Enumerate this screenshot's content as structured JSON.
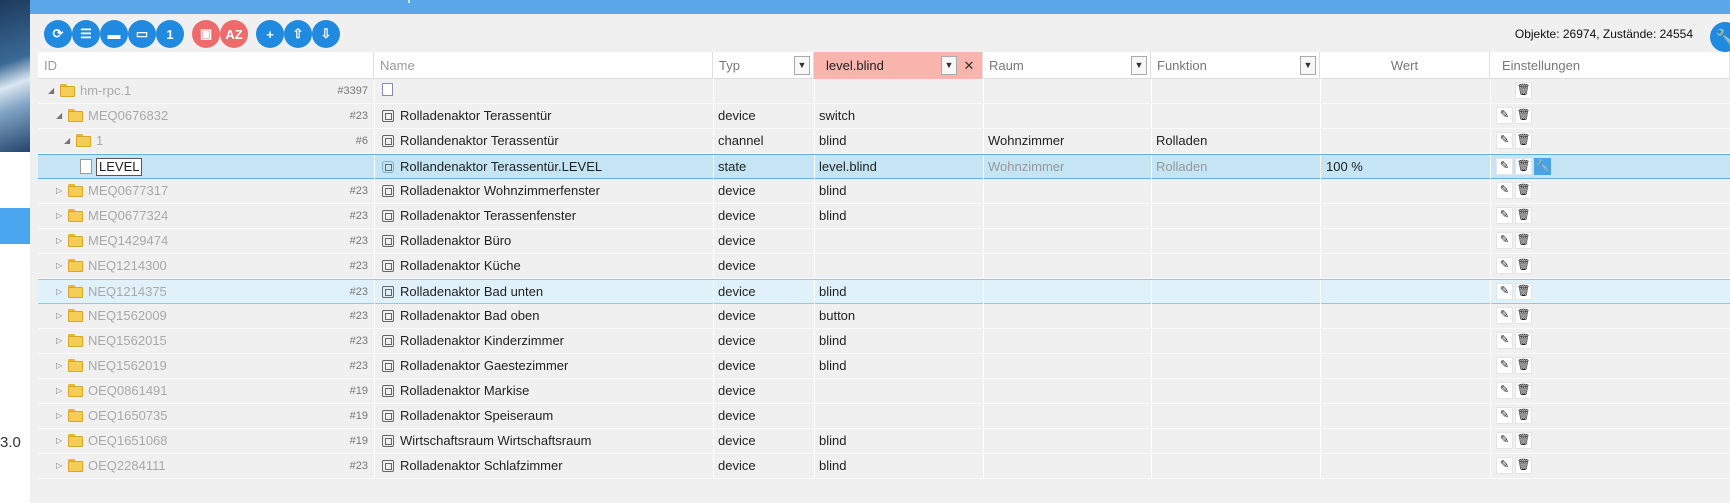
{
  "side": {
    "number": "3.0"
  },
  "toolbar": {
    "buttons": [
      {
        "name": "refresh-button",
        "glyph": "⟳"
      },
      {
        "name": "list-view-button",
        "glyph": "☰"
      },
      {
        "name": "folder-button",
        "glyph": "▬"
      },
      {
        "name": "folder-open-button",
        "glyph": "▭"
      },
      {
        "name": "page-button",
        "glyph": "1"
      },
      {
        "name": "user-button",
        "glyph": "▣"
      },
      {
        "name": "sort-az-button",
        "glyph": "AZ"
      },
      {
        "name": "add-button",
        "glyph": "+"
      },
      {
        "name": "upload-button",
        "glyph": "⇧"
      },
      {
        "name": "download-button",
        "glyph": "⇩"
      }
    ],
    "objects_text": "Objekte: 26974, Zustände: 24554"
  },
  "header": {
    "id": "ID",
    "name": "Name",
    "typ": "Typ",
    "filter_value": "level.blind",
    "raum": "Raum",
    "funktion": "Funktion",
    "wert": "Wert",
    "einstellungen": "Einstellungen"
  },
  "rows": [
    {
      "id": "hm-rpc.1",
      "count": "#3397",
      "name": "",
      "type": "",
      "role": "",
      "room": "",
      "func": "",
      "value": ""
    },
    {
      "id": "MEQ0676832",
      "count": "#23",
      "name": "Rolladenaktor Terassentür",
      "type": "device",
      "role": "switch",
      "room": "",
      "func": "",
      "value": ""
    },
    {
      "id": "1",
      "count": "#6",
      "name": "Rollandenaktor Terassentür",
      "type": "channel",
      "role": "blind",
      "room": "Wohnzimmer",
      "func": "Rolladen",
      "value": ""
    },
    {
      "id": "LEVEL",
      "count": "",
      "name": "Rollandenaktor Terassentür.LEVEL",
      "type": "state",
      "role": "level.blind",
      "room": "Wohnzimmer",
      "func": "Rolladen",
      "value": "100 %"
    },
    {
      "id": "MEQ0677317",
      "count": "#23",
      "name": "Rolladenaktor Wohnzimmerfenster",
      "type": "device",
      "role": "blind",
      "room": "",
      "func": "",
      "value": ""
    },
    {
      "id": "MEQ0677324",
      "count": "#23",
      "name": "Rolladenaktor Terassenfenster",
      "type": "device",
      "role": "blind",
      "room": "",
      "func": "",
      "value": ""
    },
    {
      "id": "MEQ1429474",
      "count": "#23",
      "name": "Rolladenaktor Büro",
      "type": "device",
      "role": "",
      "room": "",
      "func": "",
      "value": ""
    },
    {
      "id": "NEQ1214300",
      "count": "#23",
      "name": "Rolladenaktor Küche",
      "type": "device",
      "role": "",
      "room": "",
      "func": "",
      "value": ""
    },
    {
      "id": "NEQ1214375",
      "count": "#23",
      "name": "Rolladenaktor Bad unten",
      "type": "device",
      "role": "blind",
      "room": "",
      "func": "",
      "value": ""
    },
    {
      "id": "NEQ1562009",
      "count": "#23",
      "name": "Rolladenaktor Bad oben",
      "type": "device",
      "role": "button",
      "room": "",
      "func": "",
      "value": ""
    },
    {
      "id": "NEQ1562015",
      "count": "#23",
      "name": "Rolladenaktor Kinderzimmer",
      "type": "device",
      "role": "blind",
      "room": "",
      "func": "",
      "value": ""
    },
    {
      "id": "NEQ1562019",
      "count": "#23",
      "name": "Rolladenaktor Gaestezimmer",
      "type": "device",
      "role": "blind",
      "room": "",
      "func": "",
      "value": ""
    },
    {
      "id": "OEQ0861491",
      "count": "#19",
      "name": "Rolladenaktor Markise",
      "type": "device",
      "role": "",
      "room": "",
      "func": "",
      "value": ""
    },
    {
      "id": "OEQ1650735",
      "count": "#19",
      "name": "Rolladenaktor Speiseraum",
      "type": "device",
      "role": "",
      "room": "",
      "func": "",
      "value": ""
    },
    {
      "id": "OEQ1651068",
      "count": "#19",
      "name": "Wirtschaftsraum Wirtschaftsraum",
      "type": "device",
      "role": "blind",
      "room": "",
      "func": "",
      "value": ""
    },
    {
      "id": "OEQ2284111",
      "count": "#23",
      "name": "Rolladenaktor Schlafzimmer",
      "type": "device",
      "role": "blind",
      "room": "",
      "func": "",
      "value": ""
    }
  ]
}
